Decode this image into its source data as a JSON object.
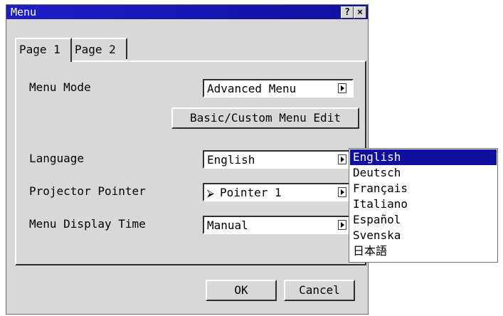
{
  "window": {
    "title": "Menu",
    "help_btn": "?",
    "close_btn": "×"
  },
  "tabs": [
    {
      "label": "Page 1"
    },
    {
      "label": "Page 2"
    }
  ],
  "fields": {
    "menu_mode": {
      "label": "Menu Mode",
      "value": "Advanced Menu"
    },
    "basic_custom_btn": "Basic/Custom Menu Edit",
    "language": {
      "label": "Language",
      "value": "English"
    },
    "projector_pointer": {
      "label": "Projector Pointer",
      "value": "Pointer 1"
    },
    "menu_display_time": {
      "label": "Menu Display Time",
      "value": "Manual"
    }
  },
  "language_options": [
    "English",
    "Deutsch",
    "Français",
    "Italiano",
    "Español",
    "Svenska",
    "日本語"
  ],
  "buttons": {
    "ok": "OK",
    "cancel": "Cancel"
  },
  "colors": {
    "titlebar": "#1010a0",
    "selection": "#1010a0",
    "face": "#d8d8d8"
  }
}
